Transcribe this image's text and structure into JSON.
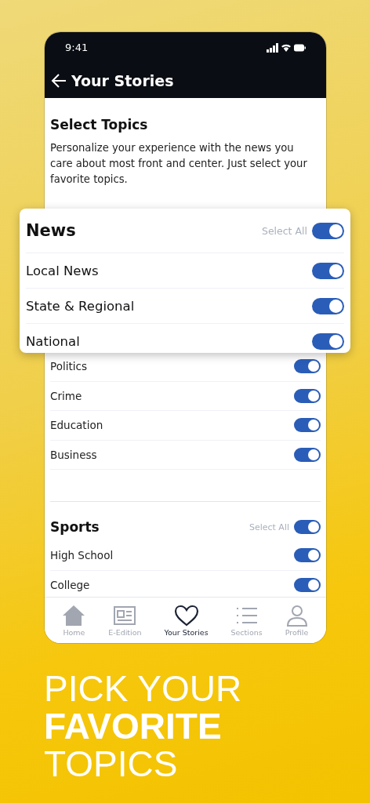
{
  "status_bar": {
    "time": "9:41"
  },
  "header": {
    "title": "Your Stories"
  },
  "intro": {
    "title": "Select Topics",
    "text": "Personalize your experience with the news you care about most front and center. Just select your favorite topics."
  },
  "featured_section": {
    "title": "News",
    "select_all": {
      "label": "Select All",
      "on": true
    },
    "items": [
      {
        "label": "Local News",
        "on": true
      },
      {
        "label": "State & Regional",
        "on": true
      },
      {
        "label": "National",
        "on": true
      }
    ]
  },
  "news_items": [
    {
      "label": "Politics",
      "on": true
    },
    {
      "label": "Crime",
      "on": true
    },
    {
      "label": "Education",
      "on": true
    },
    {
      "label": "Business",
      "on": true
    }
  ],
  "sports_section": {
    "title": "Sports",
    "select_all": {
      "label": "Select All",
      "on": true
    },
    "items": [
      {
        "label": "High School",
        "on": true
      },
      {
        "label": "College",
        "on": true
      }
    ]
  },
  "tab_bar": [
    {
      "kind": "home",
      "label": "Home",
      "selected": false
    },
    {
      "kind": "edition",
      "label": "E-Edition",
      "selected": false
    },
    {
      "kind": "heart",
      "label": "Your Stories",
      "selected": true
    },
    {
      "kind": "list",
      "label": "Sections",
      "selected": false
    },
    {
      "kind": "person",
      "label": "Profile",
      "selected": false
    }
  ],
  "headline": [
    {
      "text": "PICK YOUR",
      "bold": false
    },
    {
      "text": "FAVORITE",
      "bold": true
    },
    {
      "text": "TOPICS",
      "bold": false
    }
  ]
}
